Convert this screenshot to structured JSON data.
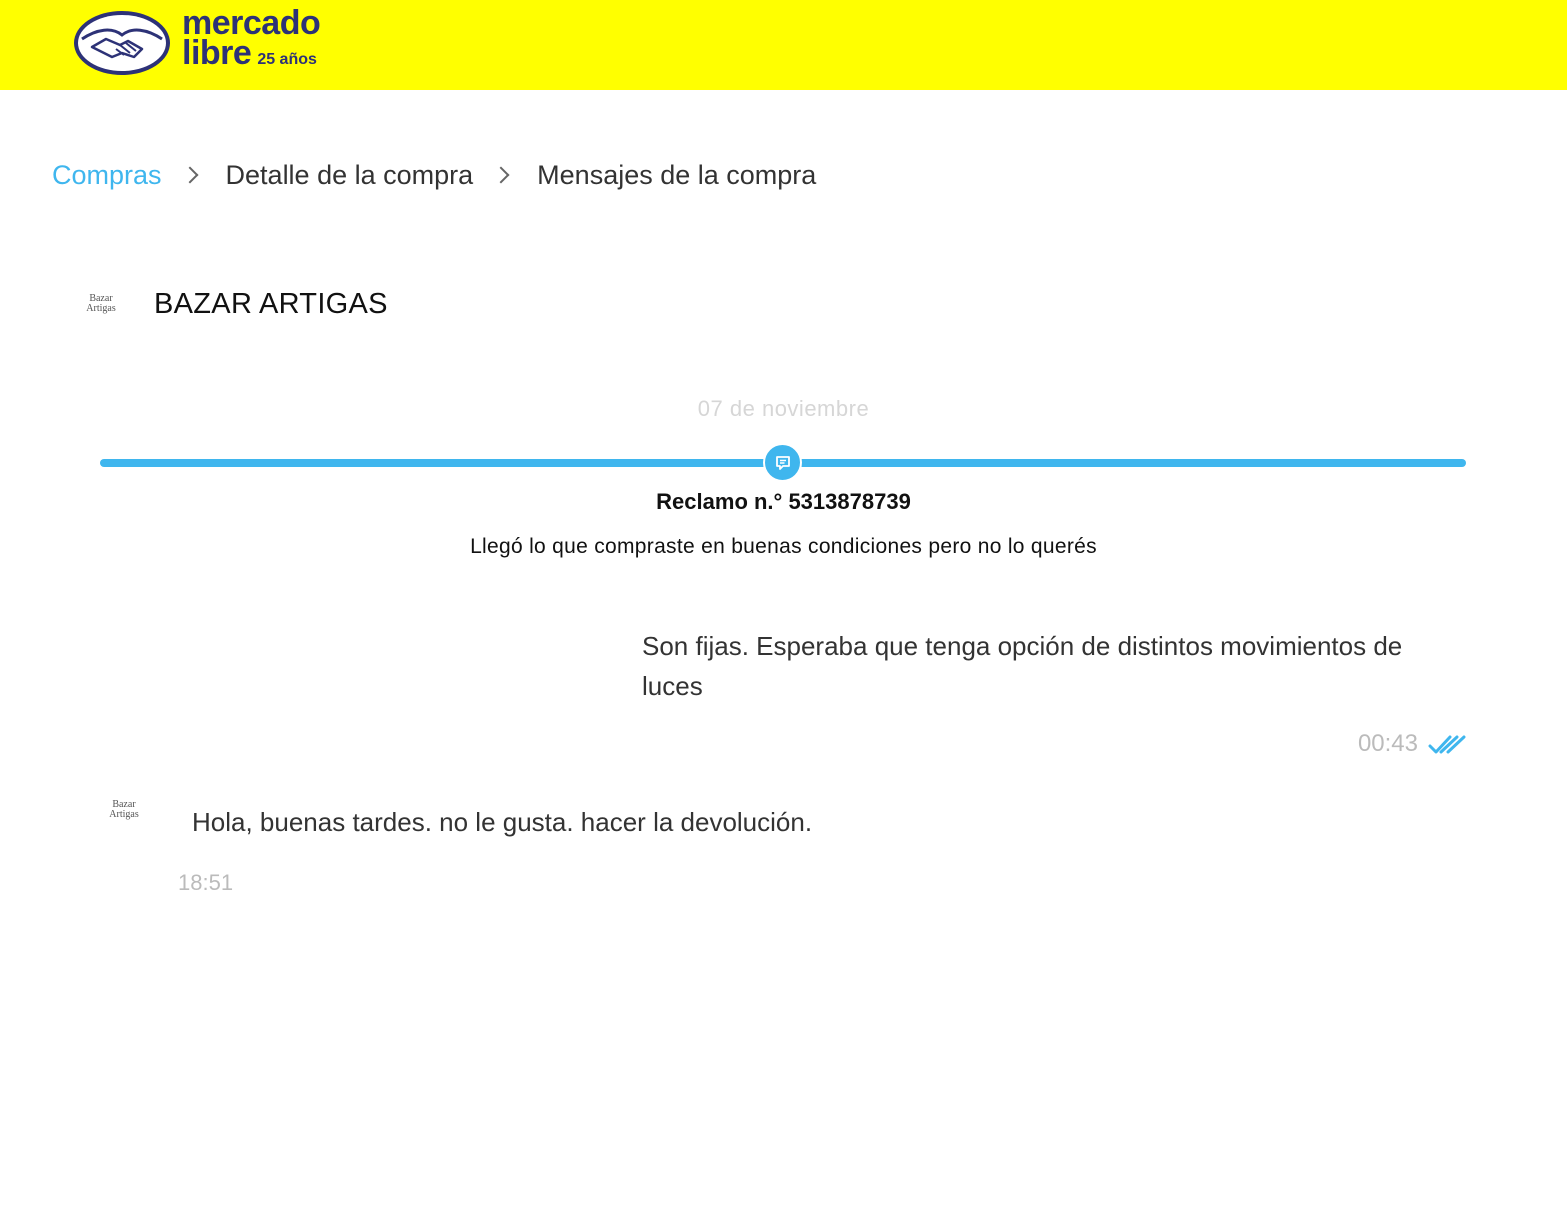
{
  "header": {
    "brand_line1": "mercado",
    "brand_line2": "libre",
    "brand_sub": "25 años",
    "brand_color": "#2d3277",
    "background": "#ffff00",
    "logo_icon": "handshake-icon"
  },
  "breadcrumb": {
    "items": [
      {
        "label": "Compras"
      },
      {
        "label": "Detalle de la compra"
      },
      {
        "label": "Mensajes de la compra"
      }
    ],
    "link_color": "#3fb6ee",
    "separator_icon": "chevron-right-icon"
  },
  "seller": {
    "name": "BAZAR ARTIGAS",
    "logo_line1": "Bazar",
    "logo_line2": "Artigas"
  },
  "timeline": {
    "date": "07 de noviembre",
    "icon": "message-icon",
    "accent_color": "#3fb6ee"
  },
  "claim": {
    "title": "Reclamo n.° 5313878739",
    "reason": "Llegó lo que compraste en buenas condiciones pero no lo querés"
  },
  "messages": [
    {
      "direction": "outgoing",
      "text": "Son fijas. Esperaba que tenga opción de distintos movimientos de luces",
      "time": "00:43",
      "status_icon": "double-check-icon"
    },
    {
      "direction": "incoming",
      "text": "Hola, buenas tardes. no le gusta. hacer la devolución.",
      "time": "18:51",
      "avatar_line1": "Bazar",
      "avatar_line2": "Artigas"
    }
  ]
}
